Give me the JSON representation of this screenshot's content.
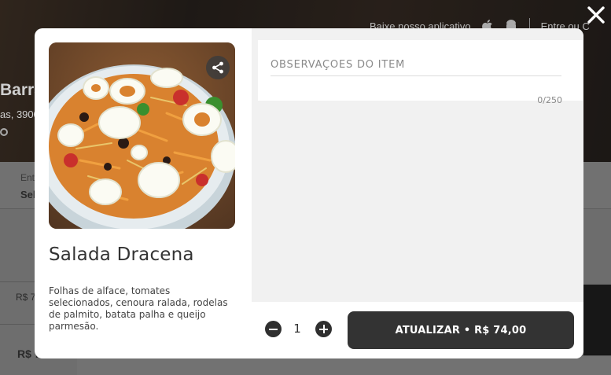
{
  "background": {
    "topbar_app_text": "Baixe nosso aplicativo",
    "topbar_login_text": "Entre ou C",
    "store_name": "Barra",
    "store_address": "as, 3900",
    "filter_label": "Ent",
    "filter_value": "Sel",
    "price_small": "R$ 7",
    "price_big": "R$ 7"
  },
  "modal": {
    "item": {
      "title": "Salada Dracena",
      "description": "Folhas de alface, tomates selecionados, cenoura ralada, rodelas de palmito, batata palha e queijo parmesão."
    },
    "observations": {
      "placeholder": "OBSERVAÇÕES DO ITEM",
      "value": "",
      "counter": "0/250"
    },
    "quantity": {
      "value": "1"
    },
    "update_button": {
      "label": "ATUALIZAR • R$ 74,00"
    }
  },
  "icons": {
    "close": "close-icon",
    "share": "share-icon",
    "apple": "apple-icon",
    "android": "android-icon",
    "minus": "minus-icon",
    "plus": "plus-icon"
  },
  "colors": {
    "primary_button": "#333333",
    "panel_background": "#f1f1f1",
    "overlay": "#3a3a3a"
  }
}
